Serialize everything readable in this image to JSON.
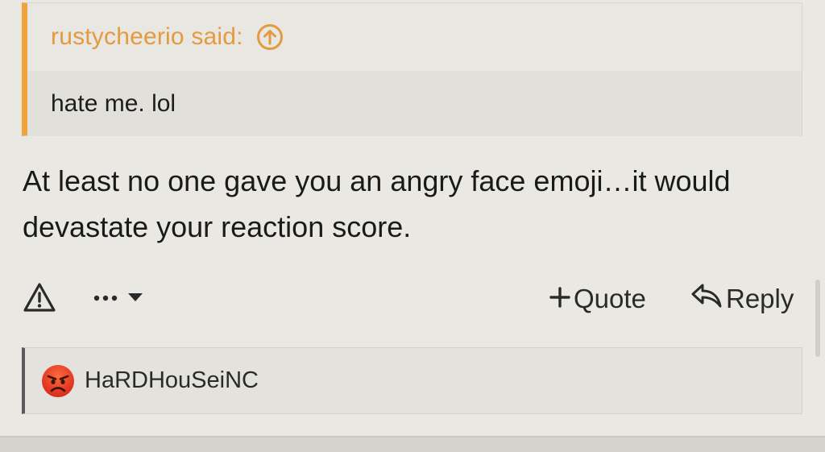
{
  "quote": {
    "author_label": "rustycheerio said:",
    "text": "hate me. lol",
    "accent_color": "#f0a33b",
    "jump_icon": "arrow-up-circle-icon"
  },
  "post": {
    "text": "At least no one gave you an angry face emoji…it would devastate your reaction score."
  },
  "actions": {
    "report_icon": "warning-triangle-icon",
    "more_icon": "ellipsis-icon",
    "more_dropdown_icon": "caret-down-icon",
    "quote_label": "Quote",
    "quote_icon": "plus-icon",
    "reply_label": "Reply",
    "reply_icon": "reply-arrow-icon"
  },
  "reactions": {
    "emoji": "angry-face-icon",
    "users": "HaRDHouSeiNC"
  }
}
